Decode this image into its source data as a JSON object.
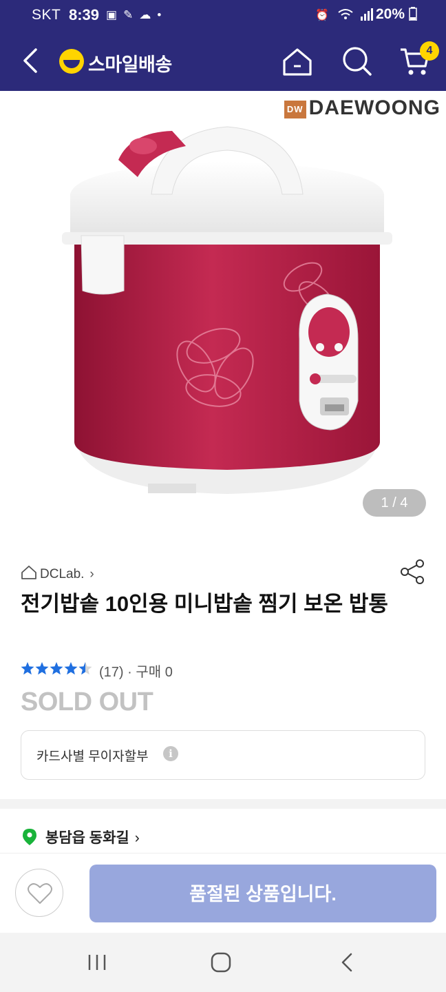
{
  "status_bar": {
    "carrier": "SKT",
    "time": "8:39",
    "battery": "20%",
    "left_icons": [
      "image-icon",
      "feather-icon",
      "cloud-icon",
      "dot-icon"
    ],
    "right_icons": [
      "alarm-icon",
      "wifi-icon",
      "signal-icon",
      "battery-icon"
    ]
  },
  "header": {
    "logo_text": "스마일배송",
    "cart_count": "4",
    "icons": [
      "back-arrow-icon",
      "home-icon",
      "search-icon",
      "cart-icon"
    ],
    "background_color": "#2c2a7a",
    "accent_color": "#ffd400"
  },
  "gallery": {
    "brand_mark": "DW",
    "brand_name": "DAEWOONG",
    "counter": "1 / 4",
    "product_colors": {
      "body": "#b51f45",
      "lid": "#f3f3f3"
    }
  },
  "product": {
    "store_name": "DCLab.",
    "title": "전기밥솥 10인용 미니밥솥 찜기 보온 밥통",
    "rating": 4.5,
    "review_count": "(17)",
    "purchase_count": "· 구매 0",
    "status": "SOLD OUT",
    "installment_label": "카드사별 무이자할부",
    "info_icon": "i"
  },
  "delivery": {
    "location": "봉담읍 동화길"
  },
  "actions": {
    "wishlist_icon": "heart-icon",
    "buy_label": "품절된 상품입니다.",
    "buy_color": "#98a7dd"
  },
  "system_nav": {
    "icons": [
      "recent-apps-icon",
      "home-circle-icon",
      "back-icon"
    ]
  }
}
